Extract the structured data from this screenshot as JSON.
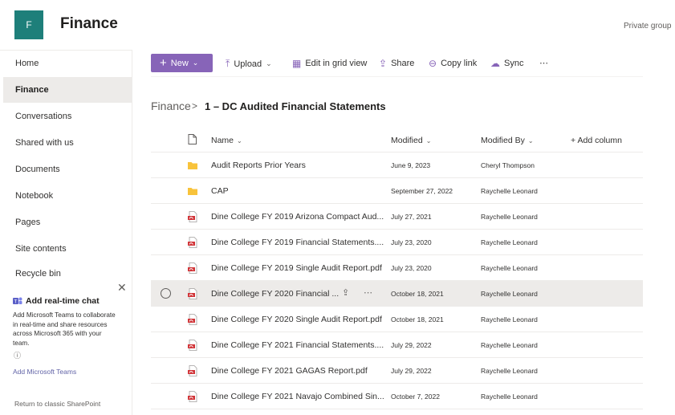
{
  "site": {
    "logo_letter": "F",
    "title": "Finance",
    "privacy": "Private group"
  },
  "nav": {
    "items": [
      {
        "label": "Home",
        "active": false
      },
      {
        "label": "Finance",
        "active": true
      },
      {
        "label": "Conversations",
        "active": false
      },
      {
        "label": "Shared with us",
        "active": false
      },
      {
        "label": "Documents",
        "active": false
      },
      {
        "label": "Notebook",
        "active": false
      },
      {
        "label": "Pages",
        "active": false
      },
      {
        "label": "Site contents",
        "active": false
      },
      {
        "label": "Recycle bin",
        "active": false
      }
    ]
  },
  "teams_card": {
    "title": "Add real-time chat",
    "description": "Add Microsoft Teams to collaborate in real-time and share resources across Microsoft 365 with your team.",
    "link": "Add Microsoft Teams",
    "return_link": "Return to classic SharePoint"
  },
  "toolbar": {
    "new_label": "New",
    "upload_label": "Upload",
    "edit_grid_label": "Edit in grid view",
    "share_label": "Share",
    "copy_link_label": "Copy link",
    "sync_label": "Sync",
    "more_label": "⋯"
  },
  "breadcrumb": {
    "root": "Finance",
    "separator": ">",
    "current": "1 – DC Audited Financial Statements"
  },
  "list": {
    "columns": {
      "name": "Name",
      "modified": "Modified",
      "modified_by": "Modified By",
      "add_column": "+ Add column"
    },
    "rows": [
      {
        "type": "folder",
        "name": "Audit Reports Prior Years",
        "modified": "June 9, 2023",
        "modified_by": "Cheryl Thompson"
      },
      {
        "type": "folder",
        "name": "CAP",
        "modified": "September 27, 2022",
        "modified_by": "Raychelle Leonard"
      },
      {
        "type": "pdf",
        "name": "Dine College FY 2019 Arizona Compact Aud...",
        "modified": "July 27, 2021",
        "modified_by": "Raychelle Leonard"
      },
      {
        "type": "pdf",
        "name": "Dine College FY 2019 Financial Statements....",
        "modified": "July 23, 2020",
        "modified_by": "Raychelle Leonard"
      },
      {
        "type": "pdf",
        "name": "Dine College FY 2019 Single Audit Report.pdf",
        "modified": "July 23, 2020",
        "modified_by": "Raychelle Leonard"
      },
      {
        "type": "pdf",
        "name": "Dine College FY 2020 Financial ...",
        "modified": "October 18, 2021",
        "modified_by": "Raychelle Leonard",
        "selected": true
      },
      {
        "type": "pdf",
        "name": "Dine College FY 2020 Single Audit Report.pdf",
        "modified": "October 18, 2021",
        "modified_by": "Raychelle Leonard"
      },
      {
        "type": "pdf",
        "name": "Dine College FY 2021 Financial Statements....",
        "modified": "July 29, 2022",
        "modified_by": "Raychelle Leonard"
      },
      {
        "type": "pdf",
        "name": "Dine College FY 2021 GAGAS Report.pdf",
        "modified": "July 29, 2022",
        "modified_by": "Raychelle Leonard"
      },
      {
        "type": "pdf",
        "name": "Dine College FY 2021 Navajo Combined Sin...",
        "modified": "October 7, 2022",
        "modified_by": "Raychelle Leonard"
      }
    ]
  },
  "colors": {
    "accent": "#8764b8",
    "brand": "#1e7f7a",
    "folder": "#f8c33b",
    "pdf": "#d13438",
    "selected_row": "#edebe9"
  }
}
